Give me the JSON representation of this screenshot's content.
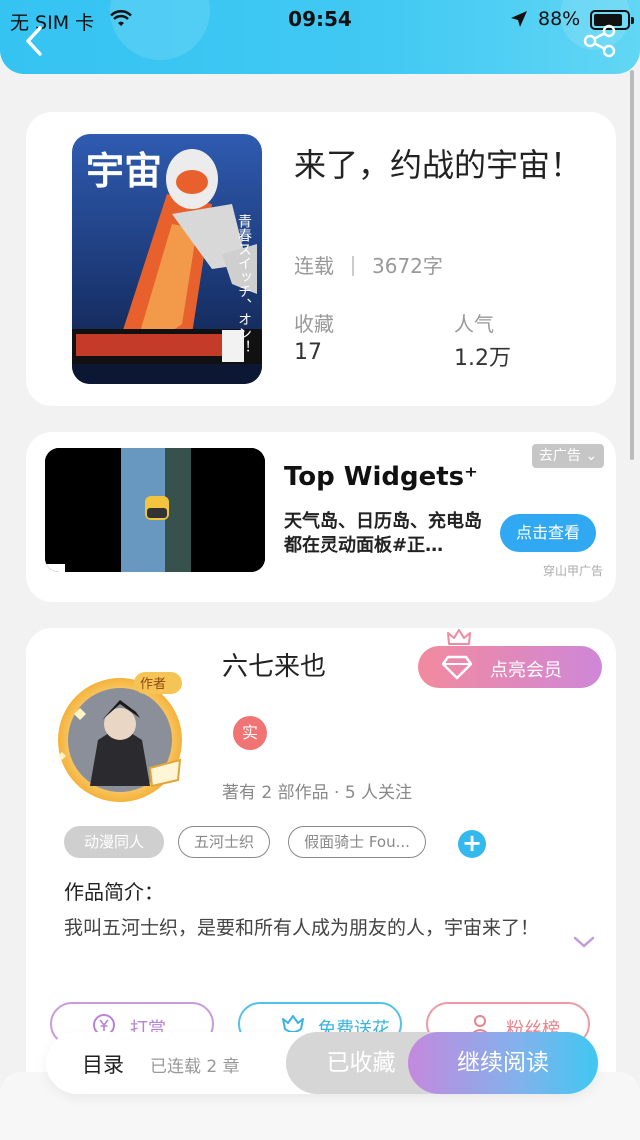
{
  "status_bar": {
    "carrier": "无 SIM 卡",
    "time": "09:54",
    "battery": "88%",
    "battery_level": 0.88
  },
  "header": {
    "back_icon": "chevron-left-icon",
    "share_icon": "share-icon"
  },
  "book": {
    "title": "来了，约战的宇宙！",
    "status": "连载",
    "word_count": "3672字",
    "favorites_label": "收藏",
    "favorites_value": "17",
    "popularity_label": "人气",
    "popularity_value": "1.2万",
    "cover": {
      "text_large": "宇宙",
      "text_side": "青春スイッチ、オン！",
      "colors": [
        "#1d3b7a",
        "#e8612c",
        "#f0f0f0"
      ]
    }
  },
  "ad": {
    "title": "Top Widgets⁺",
    "description": "天气岛、日历岛、充电岛都在灵动面板#正…",
    "close_label": "去广告",
    "cta_label": "点击查看",
    "source": "穿山甲广告"
  },
  "author": {
    "name": "六七来也",
    "badge_label": "作者",
    "real_badge": "实",
    "stats": "著有 2 部作品 · 5 人关注",
    "vip_label": "点亮会员",
    "tags": [
      "动漫同人",
      "五河士织",
      "假面骑士 Fou..."
    ],
    "intro_label": "作品简介：",
    "intro_text": "我叫五河士织，是要和所有人成为朋友的人，宇宙来了！"
  },
  "actions": {
    "tip_label": "打赏",
    "flower_label": "免费送花",
    "fans_label": "粉丝榜"
  },
  "bottom": {
    "toc_label": "目录",
    "toc_sub": "已连载 2 章",
    "collected_label": "已收藏",
    "continue_label": "继续阅读"
  },
  "colors": {
    "header": "#41c9f3",
    "accent_blue": "#33b9ee",
    "vip_pink": "#f28a9e",
    "purple": "#c489de"
  }
}
